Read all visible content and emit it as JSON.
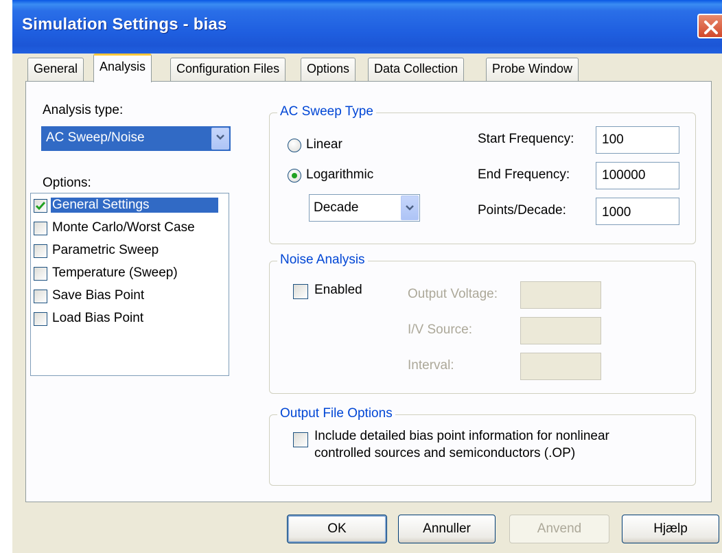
{
  "window": {
    "title": "Simulation Settings - bias"
  },
  "tabs": [
    {
      "label": "General"
    },
    {
      "label": "Analysis"
    },
    {
      "label": "Configuration Files"
    },
    {
      "label": "Options"
    },
    {
      "label": "Data Collection"
    },
    {
      "label": "Probe Window"
    }
  ],
  "active_tab": "Analysis",
  "analysis": {
    "type_label": "Analysis type:",
    "type_value": "AC Sweep/Noise",
    "options_label": "Options:",
    "options": [
      {
        "label": "General Settings",
        "checked": true,
        "selected": true
      },
      {
        "label": "Monte Carlo/Worst Case",
        "checked": false
      },
      {
        "label": "Parametric Sweep",
        "checked": false
      },
      {
        "label": "Temperature (Sweep)",
        "checked": false
      },
      {
        "label": "Save Bias Point",
        "checked": false
      },
      {
        "label": "Load Bias Point",
        "checked": false
      }
    ]
  },
  "ac_sweep": {
    "title": "AC Sweep Type",
    "linear_label": "Linear",
    "log_label": "Logarithmic",
    "selected": "Logarithmic",
    "scale_value": "Decade",
    "start_label": "Start Frequency:",
    "start_value": "100",
    "end_label": "End Frequency:",
    "end_value": "100000",
    "points_label": "Points/Decade:",
    "points_value": "1000"
  },
  "noise": {
    "title": "Noise Analysis",
    "enabled_label": "Enabled",
    "enabled": false,
    "output_voltage_label": "Output Voltage:",
    "iv_source_label": "I/V Source:",
    "interval_label": "Interval:"
  },
  "output_file": {
    "title": "Output File Options",
    "include_line1": "Include detailed bias point information for nonlinear",
    "include_line2": "controlled sources and semiconductors (.OP)",
    "include_checked": false
  },
  "buttons": {
    "ok": "OK",
    "cancel": "Annuller",
    "apply": "Anvend",
    "help": "Hjælp"
  }
}
